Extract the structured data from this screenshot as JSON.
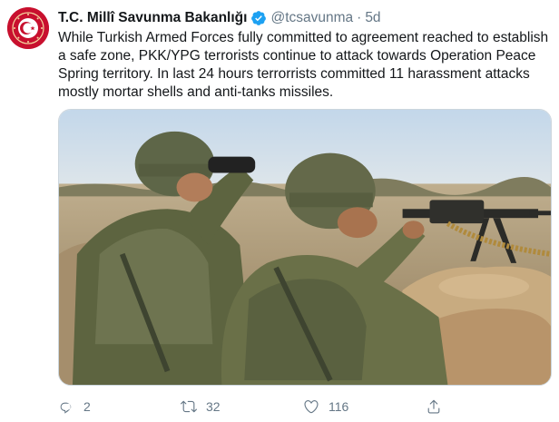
{
  "tweet": {
    "author_name": "T.C. Millî Savunma Bakanlığı",
    "handle": "@tcsavunma",
    "separator": "·",
    "time": "5d",
    "text": "While Turkish Armed Forces fully committed to agreement reached to establish a safe zone, PKK/YPG terrorists continue to attack towards Operation Peace Spring territory. In last 24 hours terrorrists committed 11 harassment attacks mostly mortar shells and anti-tanks missiles.",
    "image_description_icon": "photo-of-soldiers",
    "actions": {
      "reply": {
        "icon": "reply-icon",
        "count": "2"
      },
      "retweet": {
        "icon": "retweet-icon",
        "count": "32"
      },
      "like": {
        "icon": "heart-icon",
        "count": "116"
      },
      "share": {
        "icon": "share-icon",
        "count": ""
      }
    },
    "colors": {
      "text": "#14171a",
      "secondary": "#657786",
      "verified": "#1da1f2",
      "avatar_bg": "#c8102e"
    }
  }
}
